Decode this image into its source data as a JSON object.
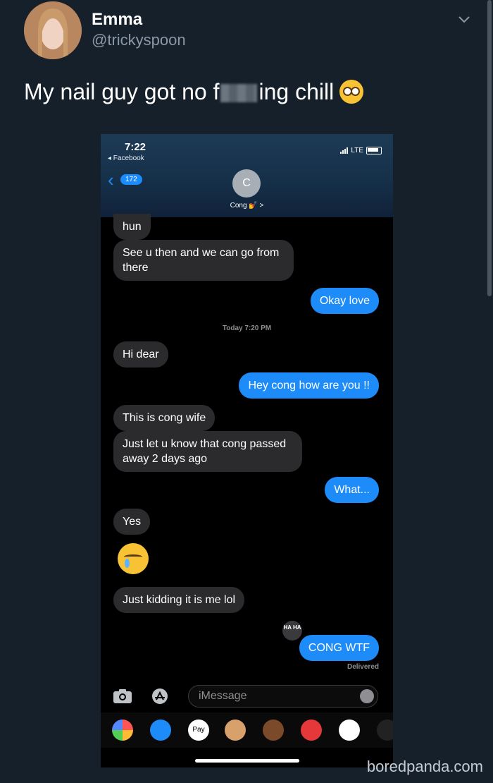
{
  "tweet": {
    "name": "Emma",
    "handle": "@trickyspoon",
    "text_before": "My nail guy got no f",
    "text_after": "ing chill"
  },
  "phone": {
    "status": {
      "time": "7:22",
      "back_app": "◂ Facebook",
      "carrier": "LTE"
    },
    "nav": {
      "back_badge": "172",
      "contact_initial": "C",
      "contact_name": "Cong 💅 >"
    },
    "messages": [
      {
        "from": "them",
        "text": "hun"
      },
      {
        "from": "them",
        "text": "See u then and we can go from there"
      },
      {
        "from": "me",
        "text": "Okay love"
      },
      {
        "from": "them",
        "text": "Hi dear"
      },
      {
        "from": "me",
        "text": "Hey cong how are you !!"
      },
      {
        "from": "them",
        "text": "This is cong wife"
      },
      {
        "from": "them",
        "text": "Just let u know that cong passed away 2 days ago"
      },
      {
        "from": "me",
        "text": "What..."
      },
      {
        "from": "them",
        "text": "Yes"
      },
      {
        "from": "them",
        "text": "Just kidding it is me lol"
      },
      {
        "from": "me",
        "text": "CONG WTF"
      }
    ],
    "timestamp": "Today 7:20 PM",
    "reaction": "HA HA",
    "delivered": "Delivered",
    "input_placeholder": "iMessage",
    "apple_pay_label": "Pay"
  },
  "watermark": "boredpanda.com",
  "colors": {
    "background": "#15202b",
    "imessage_blue": "#1d8bf8",
    "received_bubble": "#2b2b2d"
  }
}
